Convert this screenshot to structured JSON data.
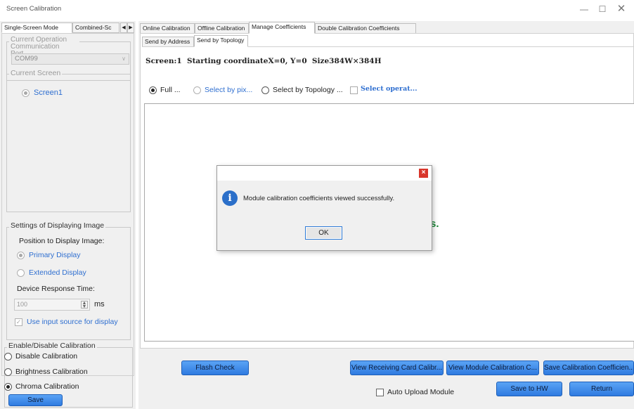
{
  "window": {
    "title": "Screen Calibration"
  },
  "left": {
    "tabs": [
      "Single-Screen Mode",
      "Combined-Sc"
    ],
    "current_port": {
      "legend": "Current Operation Communication Port",
      "value": "COM99"
    },
    "current_screen": {
      "legend": "Current Screen",
      "item": "Screen1"
    },
    "display_settings": {
      "legend": "Settings of Displaying Image",
      "position_label": "Position to Display Image:",
      "primary": "Primary Display",
      "extended": "Extended Display",
      "response_label": "Device Response Time:",
      "response_value": "100",
      "response_unit": "ms",
      "use_input": "Use input source for display"
    },
    "calibration": {
      "legend": "Enable/Disable Calibration",
      "options": [
        "Disable Calibration",
        "Brightness Calibration",
        "Chroma Calibration"
      ],
      "selected_index": 2,
      "save": "Save"
    }
  },
  "main": {
    "tabs": [
      "Online Calibration",
      "Offline Calibration",
      "Manage Coefficients",
      "Double Calibration Coefficients"
    ],
    "active_tab": 2,
    "subtabs": [
      "Send by Address",
      "Send by Topology"
    ],
    "active_subtab": 1,
    "screen_info": "Screen:1  Starting coordinateX=0, Y=0  Size384W×384H",
    "select_options": [
      "Full ...",
      "Select by pix...",
      "Select by Topology ..."
    ],
    "select_operation": "Select operat...",
    "bg_text_fragment": "s.",
    "buttons": {
      "flash_check": "Flash Check",
      "view_receiving": "View Receiving Card Calibr...",
      "view_module": "View Module Calibration C...",
      "save_coeff": "Save Calibration Coefficien...",
      "auto_upload": "Auto Upload Module",
      "save_hw": "Save to HW",
      "return": "Return"
    }
  },
  "dialog": {
    "message": "Module calibration coefficients viewed successfully.",
    "ok": "OK",
    "close": "×"
  }
}
